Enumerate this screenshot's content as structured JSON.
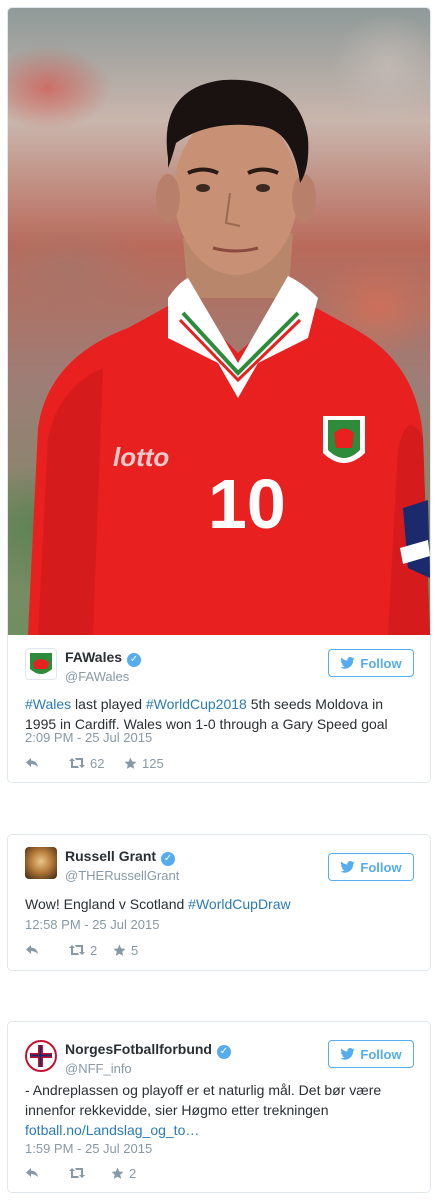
{
  "tweets": [
    {
      "display_name": "FAWales",
      "handle": "@FAWales",
      "follow_label": "Follow",
      "text_parts": [
        {
          "t": "#Wales",
          "link": true
        },
        {
          "t": " last played ",
          "link": false
        },
        {
          "t": "#WorldCup2018",
          "link": true
        },
        {
          "t": " 5th seeds Moldova in 1995 in Cardiff. Wales won 1-0 through a Gary Speed goal",
          "link": false
        }
      ],
      "timestamp": "2:09 PM - 25 Jul 2015",
      "retweets": "62",
      "favorites": "125",
      "photo": {
        "shirt_text": "lotto",
        "shirt_number": "10"
      }
    },
    {
      "display_name": "Russell Grant",
      "handle": "@THERussellGrant",
      "follow_label": "Follow",
      "text_parts": [
        {
          "t": "Wow! England v Scotland ",
          "link": false
        },
        {
          "t": "#WorldCupDraw",
          "link": true
        }
      ],
      "timestamp": "12:58 PM - 25 Jul 2015",
      "retweets": "2",
      "favorites": "5"
    },
    {
      "display_name": "NorgesFotballforbund",
      "handle": "@NFF_info",
      "follow_label": "Follow",
      "text_line1": "- Andreplassen og playoff er et naturlig mål. Det bør være",
      "text_line2": "innenfor rekkevidde, sier Høgmo etter trekningen",
      "link": "fotball.no/Landslag_og_to…",
      "timestamp": "1:59 PM - 25 Jul 2015",
      "retweets": "",
      "favorites": "2"
    }
  ],
  "colors": {
    "accent": "#55acee",
    "link": "#2b7bb9",
    "muted": "#8899a6",
    "border": "#e1e8ed",
    "shirt": "#e8201f"
  },
  "icons": [
    "verified-badge-icon",
    "twitter-bird-icon",
    "reply-icon",
    "retweet-icon",
    "favorite-star-icon"
  ]
}
